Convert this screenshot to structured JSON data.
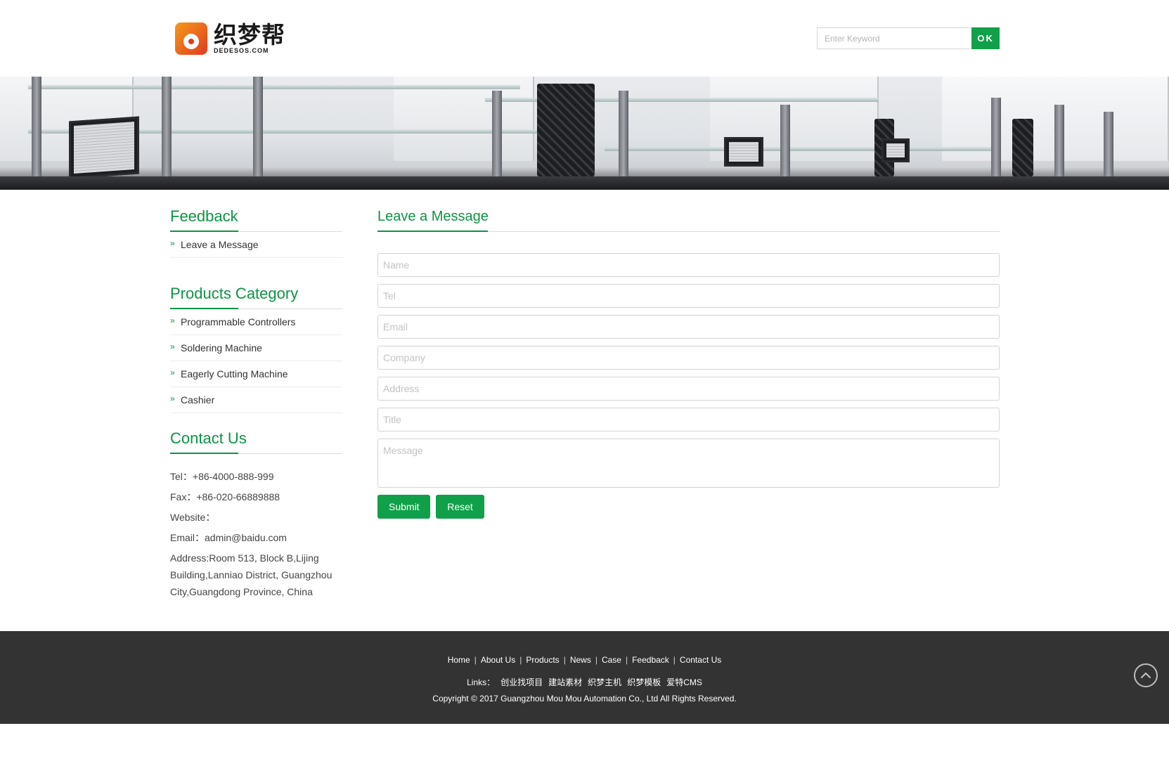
{
  "header": {
    "logo_cn": "织梦帮",
    "logo_en": "DEDESOS.COM",
    "search_placeholder": "Enter Keyword",
    "search_button": "OK"
  },
  "sidebar": {
    "feedback_title": "Feedback",
    "feedback_items": [
      {
        "label": "Leave a Message"
      }
    ],
    "products_title": "Products Category",
    "product_items": [
      {
        "label": "Programmable Controllers"
      },
      {
        "label": "Soldering Machine"
      },
      {
        "label": "Eagerly Cutting Machine"
      },
      {
        "label": "Cashier"
      }
    ],
    "contact_title": "Contact Us",
    "contact": {
      "tel": "Tel：+86-4000-888-999",
      "fax": "Fax：+86-020-66889888",
      "website": "Website：",
      "email": "Email：admin@baidu.com",
      "address": "Address:Room 513, Block B,Lijing Building,Lanniao District, Guangzhou City,Guangdong Province, China"
    }
  },
  "main": {
    "title": "Leave a Message",
    "fields": {
      "name": "Name",
      "tel": "Tel",
      "email": "Email",
      "company": "Company",
      "address": "Address",
      "title": "Title",
      "message": "Message"
    },
    "submit_label": "Submit",
    "reset_label": "Reset"
  },
  "footer": {
    "nav": [
      "Home",
      "About Us",
      "Products",
      "News",
      "Case",
      "Feedback",
      "Contact Us"
    ],
    "links_label": "Links：",
    "links": [
      "创业找项目",
      "建站素材",
      "织梦主机",
      "织梦模板",
      "爱特CMS"
    ],
    "copyright": "Copyright © 2017 Guangzhou Mou Mou Automation Co., Ltd All Rights Reserved."
  },
  "colors": {
    "accent": "#0d9444",
    "button": "#10a04a",
    "footer_bg": "#333333"
  },
  "icons": {
    "side_bullet": "chevron-double-right-icon",
    "back_to_top": "chevron-up-circle-icon"
  }
}
